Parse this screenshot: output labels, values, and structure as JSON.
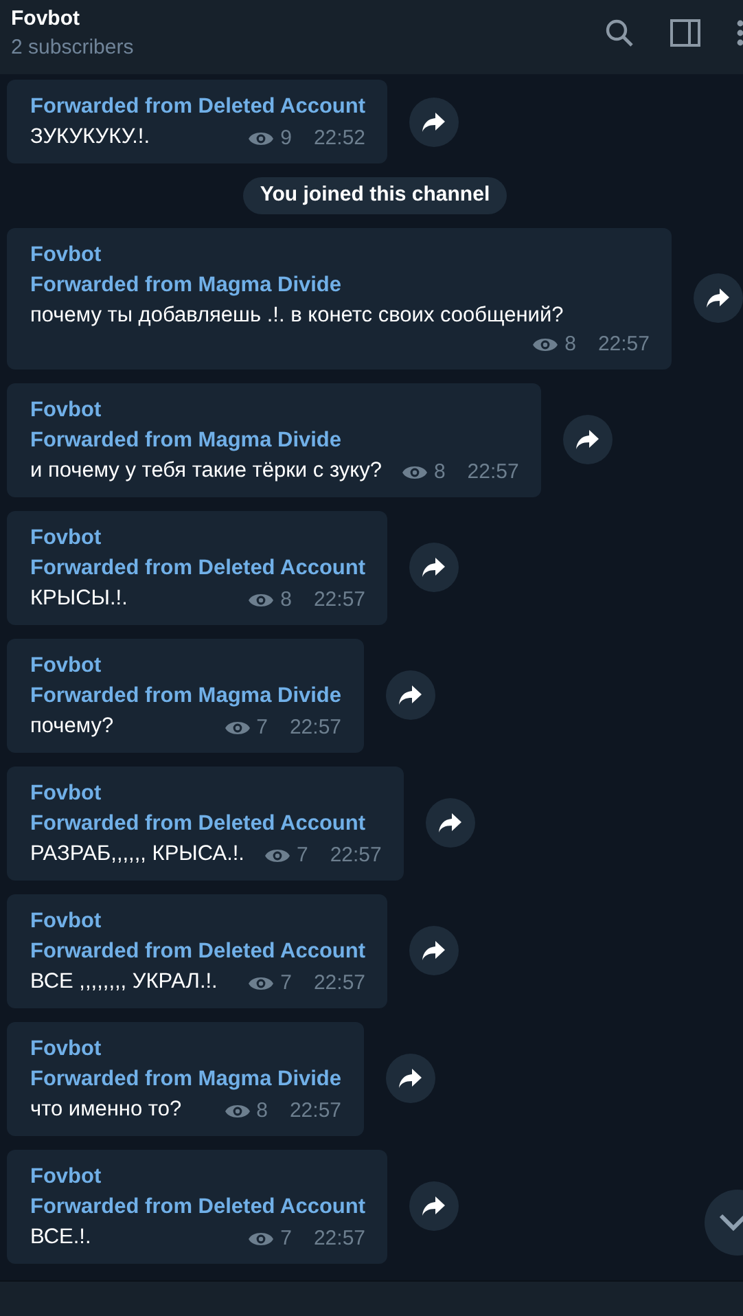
{
  "header": {
    "title": "Fovbot",
    "subtitle": "2 subscribers"
  },
  "messages": [
    {
      "kind": "post",
      "forwarded": "Forwarded from Deleted Account",
      "text": "ЗУКУКУКУ.!.",
      "views": "9",
      "time": "22:52"
    },
    {
      "kind": "service",
      "text": "You joined this channel"
    },
    {
      "kind": "post",
      "sender": "Fovbot",
      "forwarded": "Forwarded from Magma Divide",
      "text": "почему ты добавляешь .!. в конетс своих сообщений?",
      "views": "8",
      "time": "22:57"
    },
    {
      "kind": "post",
      "sender": "Fovbot",
      "forwarded": "Forwarded from Magma Divide",
      "text": "и почему у тебя такие тёрки с зуку?",
      "views": "8",
      "time": "22:57"
    },
    {
      "kind": "post",
      "sender": "Fovbot",
      "forwarded": "Forwarded from Deleted Account",
      "text": "КРЫСЫ.!.",
      "views": "8",
      "time": "22:57"
    },
    {
      "kind": "post",
      "sender": "Fovbot",
      "forwarded": "Forwarded from Magma Divide",
      "text": "почему?",
      "views": "7",
      "time": "22:57"
    },
    {
      "kind": "post",
      "sender": "Fovbot",
      "forwarded": "Forwarded from Deleted Account",
      "text": "РАЗРАБ,,,,,, КРЫСА.!.",
      "views": "7",
      "time": "22:57"
    },
    {
      "kind": "post",
      "sender": "Fovbot",
      "forwarded": "Forwarded from Deleted Account",
      "text": "ВСЕ ,,,,,,,, УКРАЛ.!.",
      "views": "7",
      "time": "22:57"
    },
    {
      "kind": "post",
      "sender": "Fovbot",
      "forwarded": "Forwarded from Magma Divide",
      "text": "что именно то?",
      "views": "8",
      "time": "22:57"
    },
    {
      "kind": "post",
      "sender": "Fovbot",
      "forwarded": "Forwarded from Deleted Account",
      "text": "ВСЕ.!.",
      "views": "7",
      "time": "22:57"
    }
  ]
}
